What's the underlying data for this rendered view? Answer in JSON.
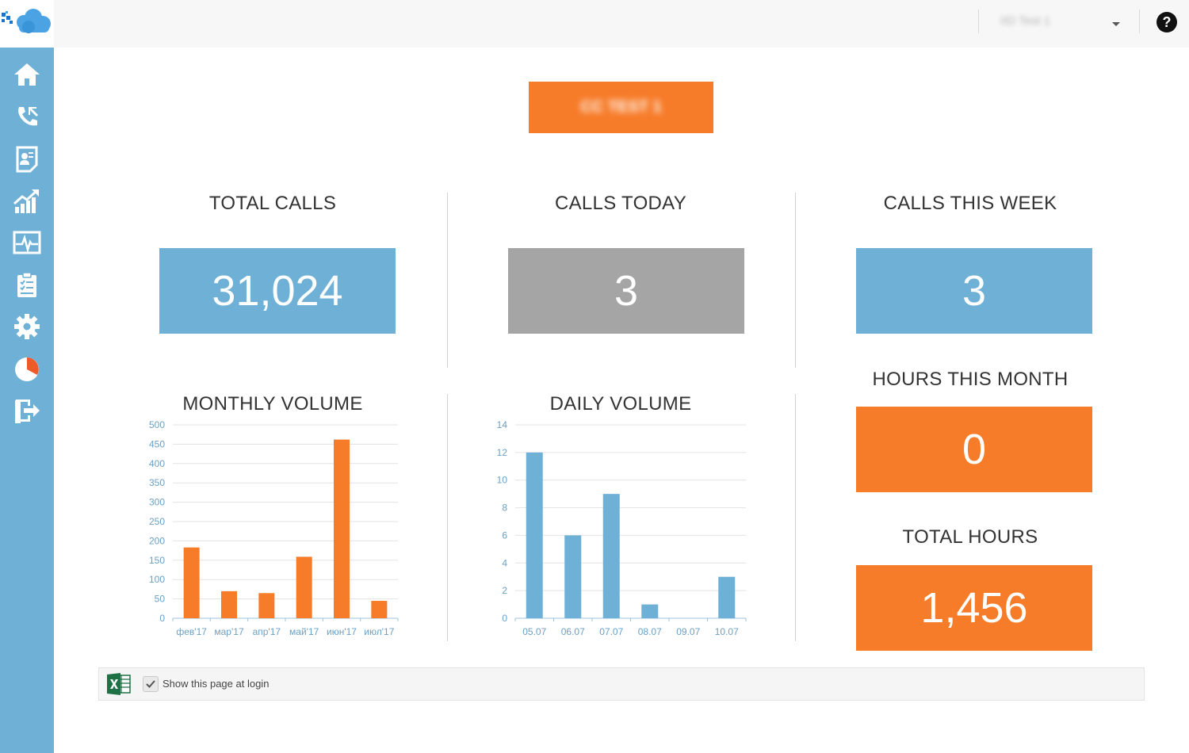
{
  "header": {
    "user_name": "IID Test 1",
    "help_label": "?"
  },
  "sidebar": {
    "items": [
      {
        "name": "home",
        "icon": "home-icon"
      },
      {
        "name": "calls",
        "icon": "phone-icon"
      },
      {
        "name": "contacts",
        "icon": "contact-card-icon"
      },
      {
        "name": "statistics",
        "icon": "growth-chart-icon"
      },
      {
        "name": "monitor",
        "icon": "pulse-icon"
      },
      {
        "name": "tasks",
        "icon": "clipboard-icon"
      },
      {
        "name": "settings",
        "icon": "gear-icon"
      },
      {
        "name": "reports",
        "icon": "pie-chart-icon"
      },
      {
        "name": "logout",
        "icon": "logout-icon"
      }
    ]
  },
  "client_banner": "CC TEST 1",
  "stats": {
    "total_calls": {
      "label": "TOTAL CALLS",
      "value": "31,024"
    },
    "calls_today": {
      "label": "CALLS TODAY",
      "value": "3"
    },
    "calls_this_week": {
      "label": "CALLS THIS WEEK",
      "value": "3"
    },
    "hours_this_month": {
      "label": "HOURS THIS MONTH",
      "value": "0"
    },
    "total_hours": {
      "label": "TOTAL HOURS",
      "value": "1,456"
    }
  },
  "colors": {
    "accent_blue": "#6eb0d6",
    "accent_orange": "#f77c2a",
    "neutral_gray": "#a5a5a5"
  },
  "chart_data": [
    {
      "type": "bar",
      "title": "MONTHLY VOLUME",
      "categories": [
        "фев'17",
        "мар'17",
        "апр'17",
        "май'17",
        "июн'17",
        "июл'17"
      ],
      "values": [
        183,
        70,
        65,
        159,
        462,
        45
      ],
      "ylim": [
        0,
        500
      ],
      "yticks": [
        0,
        50,
        100,
        150,
        200,
        250,
        300,
        350,
        400,
        450,
        500
      ],
      "color": "#f77c2a",
      "grid": true
    },
    {
      "type": "bar",
      "title": "DAILY VOLUME",
      "categories": [
        "05.07",
        "06.07",
        "07.07",
        "08.07",
        "09.07",
        "10.07"
      ],
      "values": [
        12,
        6,
        9,
        1,
        0,
        3
      ],
      "ylim": [
        0,
        14
      ],
      "yticks": [
        0,
        2,
        4,
        6,
        8,
        10,
        12,
        14
      ],
      "color": "#6eb0d6",
      "grid": true
    }
  ],
  "footer": {
    "show_at_login_label": "Show this page at login",
    "show_at_login_checked": true
  }
}
